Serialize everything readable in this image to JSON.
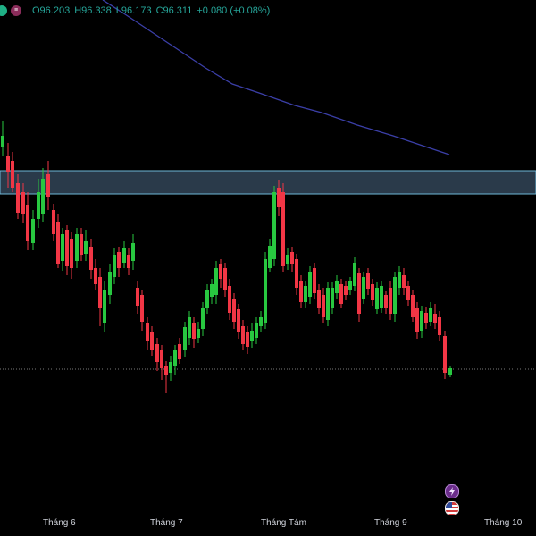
{
  "legend": {
    "open": "O96.203",
    "high": "H96.338",
    "low": "L96.173",
    "close": "C96.311",
    "change": "+0.080 (+0.08%)"
  },
  "colors": {
    "up": "#26a69a",
    "up_candle": "#28c840",
    "down_candle": "#f23645",
    "ma_line": "#3b3fa8",
    "zone_fill": "#2a3a4a",
    "zone_border": "#6fb8d8",
    "price_line": "#7a7a7a",
    "background": "#000000",
    "text": "#d1d4dc"
  },
  "x_axis": [
    "Tháng 6",
    "Tháng 7",
    "Tháng Tám",
    "Tháng 9",
    "Tháng 10"
  ],
  "event_icons": [
    "lightning-icon",
    "us-flag-icon"
  ],
  "chart_data": {
    "type": "candlestick",
    "note": "",
    "ma_series": [],
    "candles": []
  }
}
